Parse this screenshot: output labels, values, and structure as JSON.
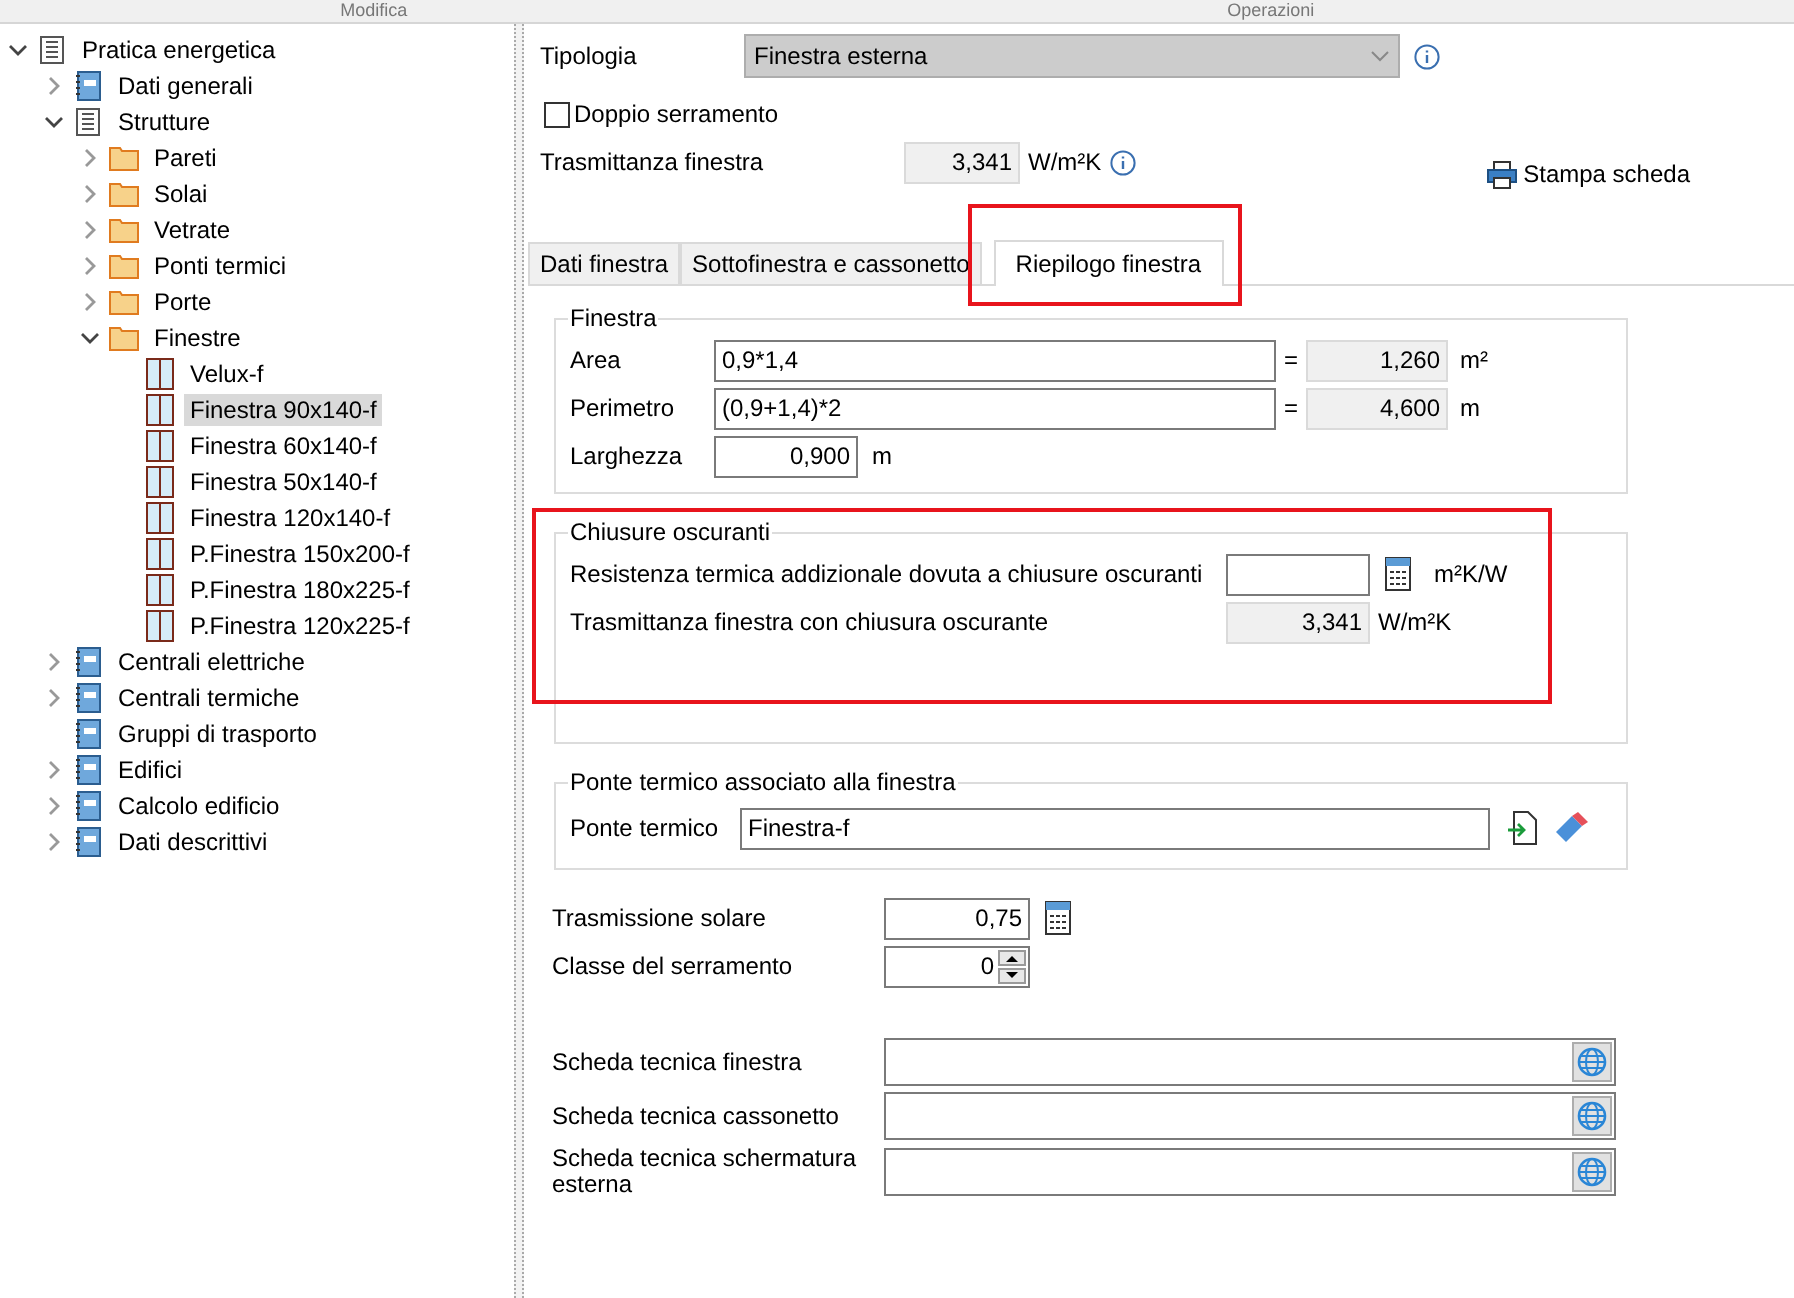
{
  "menu_strip": [
    {
      "label": "Modifica"
    },
    {
      "label": "Operazioni"
    }
  ],
  "tree": [
    {
      "label": "Pratica energetica",
      "kind": "doc",
      "expandable": true,
      "expanded": true,
      "selected": false,
      "children": [
        {
          "label": "Dati generali",
          "kind": "module",
          "expandable": true,
          "expanded": false,
          "selected": false
        },
        {
          "label": "Strutture",
          "kind": "doc",
          "expandable": true,
          "expanded": true,
          "selected": false,
          "children": [
            {
              "label": "Pareti",
              "kind": "folder",
              "expandable": true,
              "expanded": false,
              "selected": false
            },
            {
              "label": "Solai",
              "kind": "folder",
              "expandable": true,
              "expanded": false,
              "selected": false
            },
            {
              "label": "Vetrate",
              "kind": "folder",
              "expandable": true,
              "expanded": false,
              "selected": false
            },
            {
              "label": "Ponti termici",
              "kind": "folder",
              "expandable": true,
              "expanded": false,
              "selected": false
            },
            {
              "label": "Porte",
              "kind": "folder",
              "expandable": true,
              "expanded": false,
              "selected": false
            },
            {
              "label": "Finestre",
              "kind": "folder",
              "expandable": true,
              "expanded": true,
              "selected": false,
              "children": [
                {
                  "label": "Velux-f",
                  "kind": "window",
                  "expandable": false,
                  "selected": false
                },
                {
                  "label": "Finestra 90x140-f",
                  "kind": "window",
                  "expandable": false,
                  "selected": true
                },
                {
                  "label": "Finestra 60x140-f",
                  "kind": "window",
                  "expandable": false,
                  "selected": false
                },
                {
                  "label": "Finestra 50x140-f",
                  "kind": "window",
                  "expandable": false,
                  "selected": false
                },
                {
                  "label": "Finestra 120x140-f",
                  "kind": "window",
                  "expandable": false,
                  "selected": false
                },
                {
                  "label": "P.Finestra 150x200-f",
                  "kind": "window",
                  "expandable": false,
                  "selected": false
                },
                {
                  "label": "P.Finestra 180x225-f",
                  "kind": "window",
                  "expandable": false,
                  "selected": false
                },
                {
                  "label": "P.Finestra 120x225-f",
                  "kind": "window",
                  "expandable": false,
                  "selected": false
                }
              ]
            }
          ]
        },
        {
          "label": "Centrali elettriche",
          "kind": "module",
          "expandable": true,
          "expanded": false,
          "selected": false
        },
        {
          "label": "Centrali termiche",
          "kind": "module",
          "expandable": true,
          "expanded": false,
          "selected": false
        },
        {
          "label": "Gruppi di trasporto",
          "kind": "module",
          "expandable": false,
          "selected": false
        },
        {
          "label": "Edifici",
          "kind": "module",
          "expandable": true,
          "expanded": false,
          "selected": false
        },
        {
          "label": "Calcolo edificio",
          "kind": "module",
          "expandable": true,
          "expanded": false,
          "selected": false
        },
        {
          "label": "Dati descrittivi",
          "kind": "module",
          "expandable": true,
          "expanded": false,
          "selected": false
        }
      ]
    }
  ],
  "header": {
    "tipologia": {
      "label": "Tipologia",
      "value": "Finestra esterna"
    },
    "double_frame": {
      "label": "Doppio serramento",
      "checked": false
    },
    "transmittance": {
      "label": "Trasmittanza finestra",
      "value": "3,341",
      "unit": "W/m²K"
    },
    "print_button": "Stampa scheda"
  },
  "tabs": [
    {
      "label": "Dati finestra",
      "selected": false,
      "highlighted": false
    },
    {
      "label": "Sottofinestra e cassonetto",
      "selected": false,
      "highlighted": false
    },
    {
      "label": "Riepilogo finestra",
      "selected": true,
      "highlighted": true
    }
  ],
  "groups": [
    {
      "title": "Finestra",
      "kind": "dimensions",
      "highlighted": false,
      "rows": [
        {
          "kind": "formula",
          "label": "Area",
          "value": "0,9*1,4",
          "operator": "=",
          "result": "1,260",
          "unit": "m²"
        },
        {
          "kind": "formula",
          "label": "Perimetro",
          "value": "(0,9+1,4)*2",
          "operator": "=",
          "result": "4,600",
          "unit": "m"
        },
        {
          "kind": "input",
          "label": "Larghezza",
          "value": "0,900",
          "unit": "m",
          "calculator": false
        }
      ]
    },
    {
      "title": "Chiusure oscuranti",
      "kind": "shutters",
      "highlighted": true,
      "rows": [
        {
          "kind": "input",
          "label": "Resistenza termica addizionale dovuta a chiusure oscuranti",
          "unit": "m²K/W",
          "calculator": true
        },
        {
          "kind": "readonly",
          "label": "Trasmittanza finestra con chiusura oscurante",
          "value": "3,341",
          "unit": "W/m²K"
        }
      ]
    },
    {
      "title": "Ponte termico associato alla finestra",
      "kind": "bridge",
      "highlighted": false,
      "rows": [
        {
          "kind": "link",
          "label": "Ponte termico",
          "value": "Finestra-f"
        }
      ]
    }
  ],
  "extra_rows": [
    {
      "kind": "input",
      "label": "Trasmissione solare",
      "value": "0,75",
      "calculator": true
    },
    {
      "kind": "spinner",
      "label": "Classe del serramento",
      "value": "0"
    }
  ],
  "datasheets": [
    {
      "kind": "url",
      "label": "Scheda tecnica finestra"
    },
    {
      "kind": "url",
      "label": "Scheda tecnica cassonetto"
    },
    {
      "kind": "url",
      "label": "Scheda tecnica schermatura esterna"
    }
  ]
}
